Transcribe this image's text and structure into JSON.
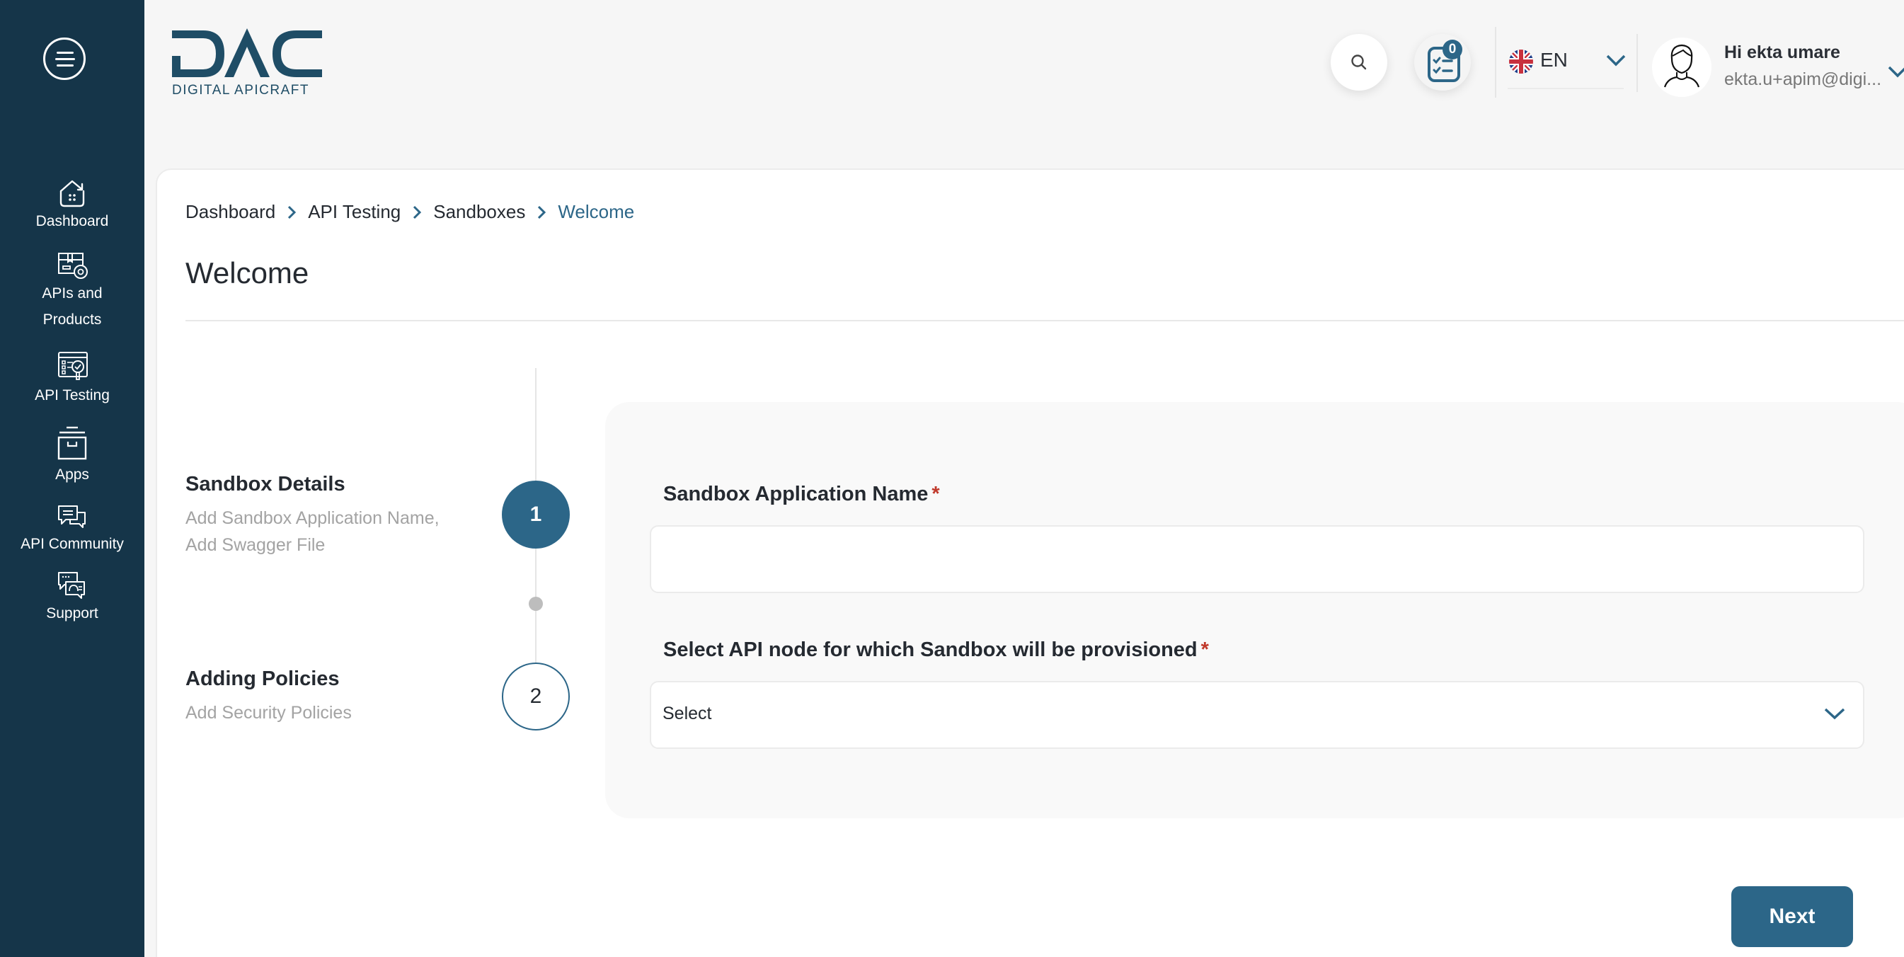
{
  "app": {
    "brand_name": "DAC",
    "brand_tagline": "DIGITAL APICRAFT",
    "accent_color": "#2c6688",
    "sidebar_color": "#153549"
  },
  "sidebar": {
    "menu_icon": "hamburger-icon",
    "items": [
      {
        "label": "Dashboard",
        "icon": "home-icon"
      },
      {
        "label": "APIs and Products",
        "label_line1": "APIs and",
        "label_line2": "Products",
        "icon": "box-gear-icon"
      },
      {
        "label": "API Testing",
        "icon": "testing-icon"
      },
      {
        "label": "Apps",
        "icon": "archive-icon"
      },
      {
        "label": "API Community",
        "icon": "chat-bubbles-icon"
      },
      {
        "label": "Support",
        "icon": "support-chat-icon"
      }
    ]
  },
  "header": {
    "search_icon": "search-icon",
    "tasks_icon": "checklist-icon",
    "tasks_badge": "0",
    "language": {
      "code": "EN",
      "flag": "uk-flag-icon"
    },
    "user": {
      "greeting": "Hi ekta umare",
      "email": "ekta.u+apim@digi..."
    }
  },
  "breadcrumb": [
    {
      "label": "Dashboard"
    },
    {
      "label": "API Testing"
    },
    {
      "label": "Sandboxes"
    },
    {
      "label": "Welcome",
      "current": true
    }
  ],
  "page": {
    "title": "Welcome"
  },
  "stepper": {
    "steps": [
      {
        "number": "1",
        "title": "Sandbox Details",
        "subtitle_line1": "Add Sandbox Application Name,",
        "subtitle_line2": "Add Swagger File",
        "state": "active"
      },
      {
        "number": "2",
        "title": "Adding Policies",
        "subtitle_line1": "Add Security Policies",
        "state": "inactive"
      }
    ]
  },
  "form": {
    "app_name": {
      "label": "Sandbox Application Name",
      "required_mark": "*",
      "value": "",
      "placeholder": ""
    },
    "api_node": {
      "label": "Select API node for which Sandbox will be provisioned",
      "required_mark": "*",
      "selected": "Select"
    }
  },
  "actions": {
    "next_label": "Next"
  }
}
